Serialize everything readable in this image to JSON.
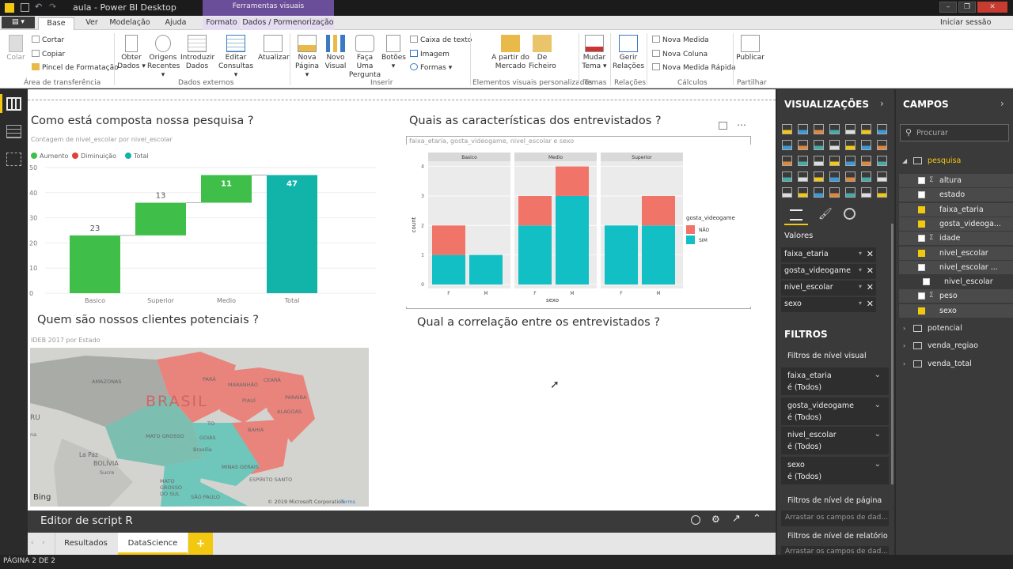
{
  "window": {
    "title": "aula - Power BI Desktop",
    "context_tab": "Ferramentas visuais"
  },
  "tabs": {
    "file": "▤ ▾",
    "items": [
      "Base",
      "Ver",
      "Modelação",
      "Ajuda",
      "Formato",
      "Dados / Pormenorização"
    ],
    "signin": "Iniciar sessão"
  },
  "ribbon": {
    "paste": "Colar",
    "cut": "Cortar",
    "copy": "Copiar",
    "format_painter": "Pincel de Formatação",
    "clipboard_group": "Área de transferência",
    "get_data": [
      "Obter",
      "Dados ▾"
    ],
    "recent_sources": [
      "Origens",
      "Recentes ▾"
    ],
    "enter_data": [
      "Introduzir",
      "Dados"
    ],
    "edit_queries": [
      "Editar",
      "Consultas ▾"
    ],
    "external_group": "Dados externos",
    "refresh": "Atualizar",
    "new_page": [
      "Nova",
      "Página ▾"
    ],
    "new_visual": [
      "Novo",
      "Visual"
    ],
    "ask_question": [
      "Faça Uma",
      "Pergunta"
    ],
    "buttons": [
      "Botões",
      "▾"
    ],
    "textbox": "Caixa de texto",
    "image": "Imagem",
    "shapes": "Formas ▾",
    "insert_group": "Inserir",
    "from_marketplace": [
      "A partir do",
      "Mercado"
    ],
    "from_file": [
      "De",
      "Ficheiro"
    ],
    "custom_visuals_group": "Elementos visuais personalizados",
    "switch_theme": [
      "Mudar",
      "Tema ▾"
    ],
    "themes_group": "Temas",
    "manage_relationships": [
      "Gerir",
      "Relações"
    ],
    "relationships_group": "Relações",
    "new_measure": "Nova Medida",
    "new_column": "Nova Coluna",
    "quick_measure": "Nova Medida Rápida",
    "calculations_group": "Cálculos",
    "publish": "Publicar",
    "share_group": "Partilhar"
  },
  "visual1": {
    "title": "Como está composta nossa pesquisa ?",
    "subtitle": "Contagem de nivel_escolar por nivel_escolar",
    "legend": [
      "Aumento",
      "Diminuição",
      "Total"
    ]
  },
  "visual2": {
    "title": "Quais as características dos entrevistados ?",
    "subtitle": "faixa_etaria, gosta_videogame, nivel_escolar e sexo",
    "facets": [
      "Basico",
      "Medio",
      "Superior"
    ],
    "y_label": "count",
    "x_label": "sexo",
    "x_ticks": [
      "F",
      "M"
    ],
    "y_ticks": [
      "0",
      "1",
      "2",
      "3",
      "4"
    ],
    "legend_title": "gosta_videogame",
    "legend_items": [
      "NÃO",
      "SIM"
    ]
  },
  "visual3": {
    "title": "Quem são nossos clientes potenciais ?",
    "subtitle": "IDEB 2017 por Estado"
  },
  "visual4": {
    "title": "Qual a correlação entre os entrevistados ?"
  },
  "map": {
    "labels": [
      "AMAZONAS",
      "PARÁ",
      "MARANHÃO",
      "CEARÁ",
      "PIAUÍ",
      "PARAÍBA",
      "ALAGOAS",
      "BAHIA",
      "TO",
      "MATO GROSSO",
      "GOIÁS",
      "Brasília",
      "MINAS GERAIS",
      "ESPÍRITO SANTO",
      "MATO GROSSO DO SUL",
      "SÃO PAULO",
      "BOLÍVIA",
      "La Paz",
      "Sucre",
      "RU",
      "na",
      "BRASIL"
    ],
    "bing": "Bing",
    "copyright": "© 2019 Microsoft Corporation",
    "terms": "Terms"
  },
  "script_editor": {
    "label": "Editor de script R"
  },
  "page_tabs": {
    "items": [
      "Resultados",
      "DataScience"
    ],
    "add": "+"
  },
  "status": {
    "page": "PÁGINA 2 DE 2"
  },
  "visualizations": {
    "header": "VISUALIZAÇÕES",
    "values_label": "Valores",
    "wells": [
      "faixa_etaria",
      "gosta_videogame",
      "nivel_escolar",
      "sexo"
    ],
    "filters_header": "FILTROS",
    "visual_filters_label": "Filtros de nível visual",
    "filters": [
      {
        "name": "faixa_etaria",
        "state": "é (Todos)"
      },
      {
        "name": "gosta_videogame",
        "state": "é (Todos)"
      },
      {
        "name": "nivel_escolar",
        "state": "é (Todos)"
      },
      {
        "name": "sexo",
        "state": "é (Todos)"
      }
    ],
    "page_filters_label": "Filtros de nível de página",
    "drag_fields": "Arrastar os campos de dad...",
    "report_filters_label": "Filtros de nível de relatório",
    "drag_fields2": "Arrastar os campos de dad..."
  },
  "fields": {
    "header": "CAMPOS",
    "search_placeholder": "Procurar",
    "tables": [
      "pesquisa",
      "potencial",
      "venda_regiao",
      "venda_total"
    ],
    "pesquisa_fields": [
      {
        "name": "altura",
        "sigma": "Σ",
        "checked": false
      },
      {
        "name": "estado",
        "sigma": "",
        "checked": false
      },
      {
        "name": "faixa_etaria",
        "sigma": "",
        "checked": true
      },
      {
        "name": "gosta_videoga...",
        "sigma": "",
        "checked": true
      },
      {
        "name": "idade",
        "sigma": "Σ",
        "checked": false
      },
      {
        "name": "nivel_escolar",
        "sigma": "",
        "checked": true
      },
      {
        "name": "nivel_escolar ...",
        "sigma": "",
        "checked": false
      },
      {
        "name": "nivel_escolar",
        "sigma": "",
        "checked": false
      },
      {
        "name": "peso",
        "sigma": "Σ",
        "checked": false
      },
      {
        "name": "sexo",
        "sigma": "",
        "checked": true
      }
    ]
  },
  "chart_data": [
    {
      "type": "bar",
      "title": "Como está composta nossa pesquisa ?",
      "categories": [
        "Basico",
        "Superior",
        "Medio",
        "Total"
      ],
      "values": [
        23,
        13,
        11,
        47
      ],
      "bar_kind": [
        "Aumento",
        "Aumento",
        "Aumento",
        "Total"
      ],
      "y_ticks": [
        0,
        10,
        20,
        30,
        40,
        50
      ],
      "ylim": [
        0,
        50
      ],
      "colors": {
        "Aumento": "#3fbf4a",
        "Diminuição": "#e0403a",
        "Total": "#12b3a8"
      }
    },
    {
      "type": "bar",
      "title": "Quais as características dos entrevistados ?",
      "facets": [
        "Basico",
        "Medio",
        "Superior"
      ],
      "categories": [
        "F",
        "M"
      ],
      "series": [
        {
          "name": "SIM",
          "values": {
            "Basico": [
              1,
              1
            ],
            "Medio": [
              2,
              3
            ],
            "Superior": [
              2,
              2
            ]
          }
        },
        {
          "name": "NÃO",
          "values": {
            "Basico": [
              1,
              0
            ],
            "Medio": [
              1,
              1
            ],
            "Superior": [
              0,
              1
            ]
          }
        }
      ],
      "ylabel": "count",
      "xlabel": "sexo",
      "ylim": [
        0,
        4
      ],
      "colors": {
        "NÃO": "#f07468",
        "SIM": "#12bfc4"
      }
    }
  ]
}
